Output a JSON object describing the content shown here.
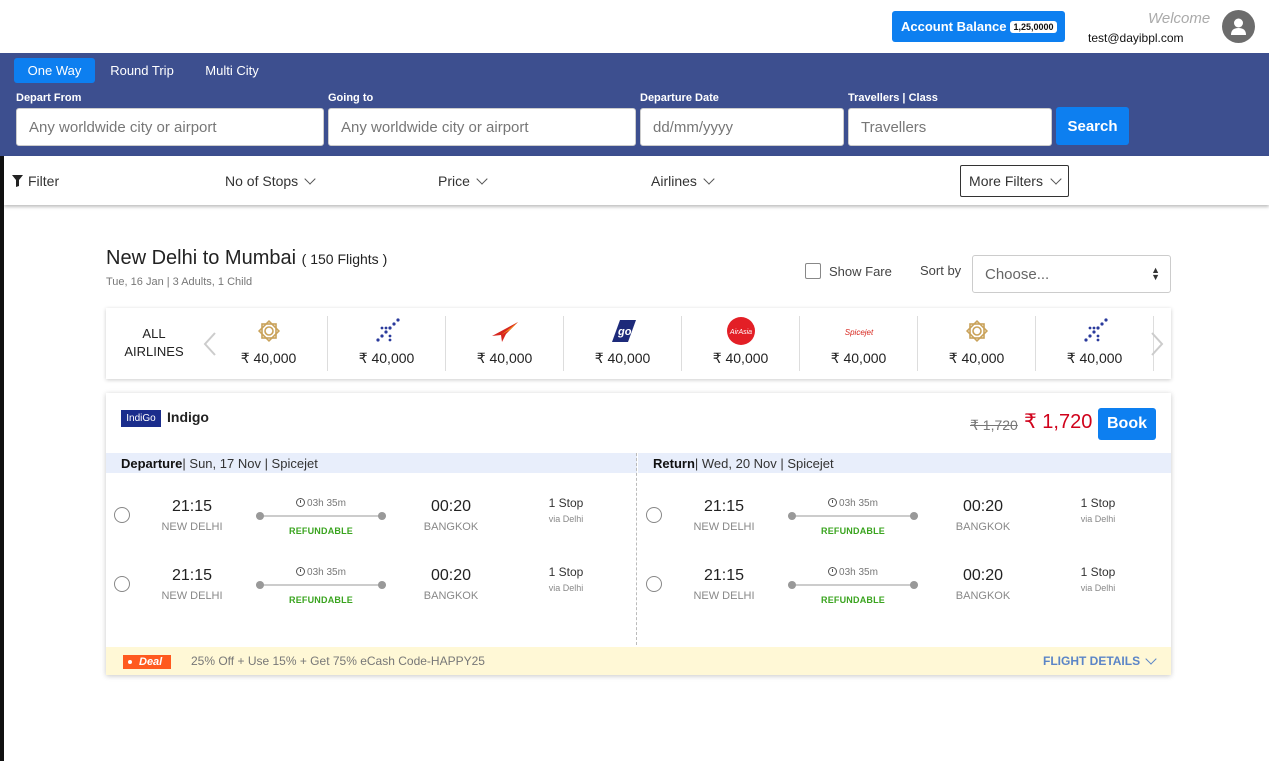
{
  "header": {
    "account_balance_label": "Account Balance",
    "account_balance_value": "1,25,0000",
    "welcome": "Welcome",
    "email": "test@dayibpl.com"
  },
  "search": {
    "tabs": [
      "One Way",
      "Round Trip",
      "Multi City"
    ],
    "active_tab": "One Way",
    "depart_label": "Depart From",
    "depart_placeholder": "Any worldwide city or airport",
    "going_label": "Going to",
    "going_placeholder": "Any worldwide city or airport",
    "date_label": "Departure Date",
    "date_placeholder": "dd/mm/yyyy",
    "travellers_label": "Travellers | Class",
    "travellers_placeholder": "Travellers",
    "search_button": "Search"
  },
  "filters": {
    "filter_label": "Filter",
    "stops": "No of Stops",
    "price": "Price",
    "airlines": "Airlines",
    "more": "More Filters"
  },
  "results": {
    "route": "New Delhi to Mumbai",
    "count": "( 150 Flights )",
    "subtitle": "Tue, 16 Jan | 3 Adults, 1 Child",
    "show_fare": "Show Fare",
    "sort_label": "Sort by",
    "sort_value": "Choose..."
  },
  "airline_strip": {
    "all_label_1": "ALL",
    "all_label_2": "AIRLINES",
    "items": [
      {
        "icon": "vistara-logo-icon",
        "price": "₹ 40,000"
      },
      {
        "icon": "plane-dots-logo-icon",
        "price": "₹ 40,000"
      },
      {
        "icon": "air-india-logo-icon",
        "price": "₹ 40,000"
      },
      {
        "icon": "goair-logo-icon",
        "price": "₹ 40,000"
      },
      {
        "icon": "airasia-logo-icon",
        "price": "₹ 40,000"
      },
      {
        "icon": "spicejet-logo-icon",
        "price": "₹ 40,000"
      },
      {
        "icon": "vistara-logo-icon",
        "price": "₹ 40,000"
      },
      {
        "icon": "plane-dots-logo-icon",
        "price": "₹ 40,000"
      }
    ],
    "spicejet_text": "Spicejet",
    "airasia_text": "AirAsia",
    "go_text": "go"
  },
  "card": {
    "logo_text": "IndiGo",
    "airline": "Indigo",
    "old_price": "₹ 1,720",
    "new_price": "₹ 1,720",
    "book": "Book",
    "departure_head": "Departure",
    "departure_info": " | Sun, 17 Nov | Spicejet",
    "return_head": "Return",
    "return_info": " | Wed, 20 Nov | Spicejet",
    "rows": [
      {
        "dep_time": "21:15",
        "dep_city": "NEW DELHI",
        "duration": "03h 35m",
        "refund": "REFUNDABLE",
        "arr_time": "00:20",
        "arr_city": "BANGKOK",
        "stops": "1 Stop",
        "via": "via Delhi"
      },
      {
        "dep_time": "21:15",
        "dep_city": "NEW DELHI",
        "duration": "03h 35m",
        "refund": "REFUNDABLE",
        "arr_time": "00:20",
        "arr_city": "BANGKOK",
        "stops": "1 Stop",
        "via": "via Delhi"
      }
    ],
    "deal_tag": "Deal",
    "deal_text": "25% Off + Use 15% + Get 75% eCash Code-HAPPY25",
    "flight_details": "FLIGHT DETAILS"
  },
  "colors": {
    "primary": "#0d7ff0",
    "band": "#3d4f8f",
    "price_red": "#d0021b",
    "refund_green": "#3aa41f",
    "deal_orange": "#ff5a1f"
  }
}
